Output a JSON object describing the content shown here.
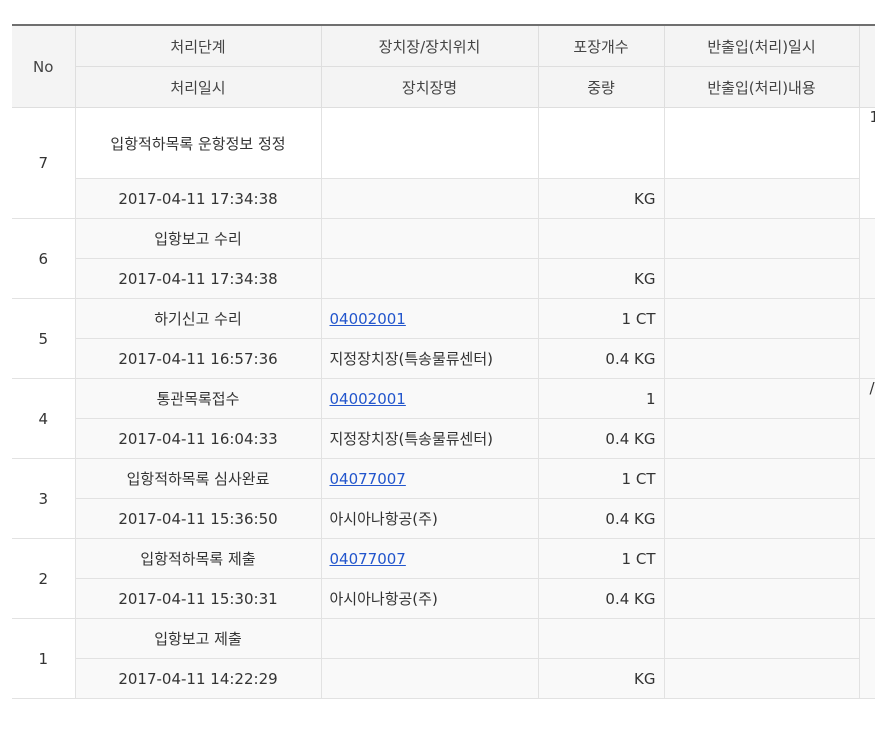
{
  "header": {
    "no": "No",
    "row1": [
      "처리단계",
      "장치장/장치위치",
      "포장개수",
      "반출입(처리)일시"
    ],
    "row2": [
      "처리일시",
      "장치장명",
      "중량",
      "반출입(처리)내용"
    ]
  },
  "rows": [
    {
      "no": "7",
      "step": "입항적하목록 운항정보 정정",
      "location_code": "",
      "packages": "",
      "inout_datetime": "",
      "extra": "1",
      "datetime": "2017-04-11 17:34:38",
      "location_name": "",
      "weight": "KG",
      "inout_content": ""
    },
    {
      "no": "6",
      "step": "입항보고 수리",
      "location_code": "",
      "packages": "",
      "inout_datetime": "",
      "extra": "",
      "datetime": "2017-04-11 17:34:38",
      "location_name": "",
      "weight": "KG",
      "inout_content": ""
    },
    {
      "no": "5",
      "step": "하기신고 수리",
      "location_code": "04002001",
      "packages": "1 CT",
      "inout_datetime": "",
      "extra": "",
      "datetime": "2017-04-11 16:57:36",
      "location_name": "지정장치장(특송물류센터)",
      "weight": "0.4 KG",
      "inout_content": ""
    },
    {
      "no": "4",
      "step": "통관목록접수",
      "location_code": "04002001",
      "packages": "1",
      "inout_datetime": "",
      "extra": "/",
      "datetime": "2017-04-11 16:04:33",
      "location_name": "지정장치장(특송물류센터)",
      "weight": "0.4 KG",
      "inout_content": ""
    },
    {
      "no": "3",
      "step": "입항적하목록 심사완료",
      "location_code": "04077007",
      "packages": "1 CT",
      "inout_datetime": "",
      "extra": "",
      "datetime": "2017-04-11 15:36:50",
      "location_name": "아시아나항공(주)",
      "weight": "0.4 KG",
      "inout_content": ""
    },
    {
      "no": "2",
      "step": "입항적하목록 제출",
      "location_code": "04077007",
      "packages": "1 CT",
      "inout_datetime": "",
      "extra": "",
      "datetime": "2017-04-11 15:30:31",
      "location_name": "아시아나항공(주)",
      "weight": "0.4 KG",
      "inout_content": ""
    },
    {
      "no": "1",
      "step": "입항보고 제출",
      "location_code": "",
      "packages": "",
      "inout_datetime": "",
      "extra": "",
      "datetime": "2017-04-11 14:22:29",
      "location_name": "",
      "weight": "KG",
      "inout_content": ""
    }
  ]
}
